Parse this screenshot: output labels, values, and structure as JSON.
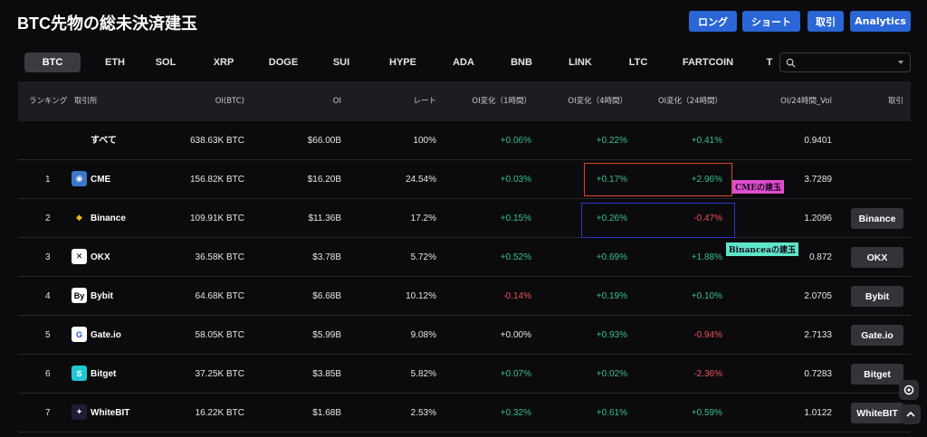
{
  "title": "BTC先物の総未決済建玉",
  "actions": {
    "long": "ロング",
    "short": "ショート",
    "trade": "取引",
    "analytics": "Analytics"
  },
  "tabs": [
    "BTC",
    "ETH",
    "SOL",
    "XRP",
    "DOGE",
    "SUI",
    "HYPE",
    "ADA",
    "BNB",
    "LINK",
    "LTC",
    "FARTCOIN",
    "T"
  ],
  "active_tab": "BTC",
  "search": {
    "placeholder": "",
    "icon": "search-icon"
  },
  "columns": {
    "rank": "ランキング",
    "exchange": "取引所",
    "oi_btc": "OI(BTC)",
    "oi": "OI",
    "rate": "レート",
    "oi_1h": "OI変化（1時間）",
    "oi_4h": "OI変化（4時間）",
    "oi_24h": "OI変化（24時間）",
    "oi_vol": "OI/24時間_Vol",
    "trade": "取引"
  },
  "all_row": {
    "name": "すべて",
    "oi_btc": "638.63K BTC",
    "oi": "$66.00B",
    "rate": "100%",
    "oi_1h": "+0.06%",
    "oi_4h": "+0.22%",
    "oi_24h": "+0.41%",
    "oi_vol": "0.9401"
  },
  "rows": [
    {
      "rank": "1",
      "name": "CME",
      "oi_btc": "156.82K BTC",
      "oi": "$16.20B",
      "rate": "24.54%",
      "oi_1h": "+0.03%",
      "oi_4h": "+0.17%",
      "oi_24h": "+2.96%",
      "oi_vol": "3.7289",
      "trade": ""
    },
    {
      "rank": "2",
      "name": "Binance",
      "oi_btc": "109.91K BTC",
      "oi": "$11.36B",
      "rate": "17.2%",
      "oi_1h": "+0.15%",
      "oi_4h": "+0.26%",
      "oi_24h": "-0.47%",
      "oi_vol": "1.2096",
      "trade": "Binance"
    },
    {
      "rank": "3",
      "name": "OKX",
      "oi_btc": "36.58K BTC",
      "oi": "$3.78B",
      "rate": "5.72%",
      "oi_1h": "+0.52%",
      "oi_4h": "+0.69%",
      "oi_24h": "+1.88%",
      "oi_vol": "0.872",
      "trade": "OKX"
    },
    {
      "rank": "4",
      "name": "Bybit",
      "oi_btc": "64.68K BTC",
      "oi": "$6.68B",
      "rate": "10.12%",
      "oi_1h": "-0.14%",
      "oi_4h": "+0.19%",
      "oi_24h": "+0.10%",
      "oi_vol": "2.0705",
      "trade": "Bybit"
    },
    {
      "rank": "5",
      "name": "Gate.io",
      "oi_btc": "58.05K BTC",
      "oi": "$5.99B",
      "rate": "9.08%",
      "oi_1h": "+0.00%",
      "oi_4h": "+0.93%",
      "oi_24h": "-0.94%",
      "oi_vol": "2.7133",
      "trade": "Gate.io"
    },
    {
      "rank": "6",
      "name": "Bitget",
      "oi_btc": "37.25K BTC",
      "oi": "$3.85B",
      "rate": "5.82%",
      "oi_1h": "+0.07%",
      "oi_4h": "+0.02%",
      "oi_24h": "-2.36%",
      "oi_vol": "0.7283",
      "trade": "Bitget"
    },
    {
      "rank": "7",
      "name": "WhiteBIT",
      "oi_btc": "16.22K BTC",
      "oi": "$1.68B",
      "rate": "2.53%",
      "oi_1h": "+0.32%",
      "oi_4h": "+0.61%",
      "oi_24h": "+0.59%",
      "oi_vol": "1.0122",
      "trade": "WhiteBIT"
    }
  ],
  "annotations": {
    "cme": "CMEの建玉",
    "binance": "Binanceaの建玉"
  },
  "logos": {
    "CME": {
      "bg": "#3a78c9",
      "fg": "#ffffff",
      "glyph": "◉"
    },
    "Binance": {
      "bg": "#0b0b0d",
      "fg": "#f0b90b",
      "glyph": "◆"
    },
    "OKX": {
      "bg": "#ffffff",
      "fg": "#000000",
      "glyph": "✕"
    },
    "Bybit": {
      "bg": "#ffffff",
      "fg": "#000000",
      "glyph": "By"
    },
    "Gate.io": {
      "bg": "#ffffff",
      "fg": "#2354e6",
      "glyph": "G"
    },
    "Bitget": {
      "bg": "#1fc7d4",
      "fg": "#ffffff",
      "glyph": "S"
    },
    "WhiteBIT": {
      "bg": "#1d1d35",
      "fg": "#ffffff",
      "glyph": "✦"
    }
  },
  "colors": {
    "accent": "#2a66d6",
    "up": "#35c08b",
    "down": "#ef4f5a",
    "cme_box": "#d9482b",
    "binance_box": "#2638c9",
    "cme_label_bg": "#e04ccf",
    "binance_label_bg": "#5fe6c8"
  }
}
